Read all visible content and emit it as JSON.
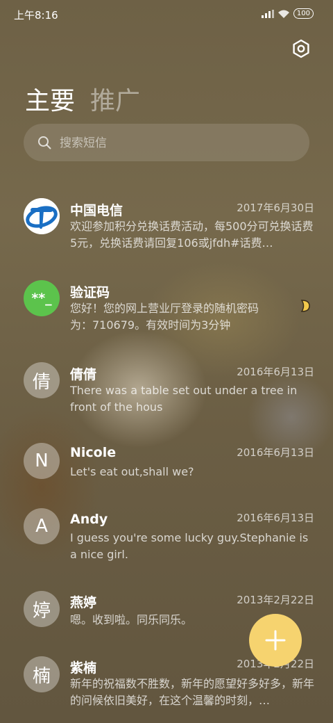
{
  "status_bar": {
    "time": "上午8:16",
    "battery": "100"
  },
  "tabs": [
    {
      "label": "主要"
    },
    {
      "label": "推广"
    }
  ],
  "search": {
    "placeholder": "搜索短信"
  },
  "conversations": [
    {
      "name": "中国电信",
      "date": "2017年6月30日",
      "preview": "欢迎参加积分兑换话费活动，每500分可兑换话费5元，兑换话费请回复106或jfdh#话费…"
    },
    {
      "name": "验证码",
      "avatar_text": "**_",
      "date": "",
      "preview": "您好！您的网上营业厅登录的随机密码为：710679。有效时间为3分钟"
    },
    {
      "name": "倩倩",
      "avatar_text": "倩",
      "date": "2016年6月13日",
      "preview": "There was a table set out under a tree in front of the hous"
    },
    {
      "name": "Nicole",
      "avatar_text": "N",
      "date": "2016年6月13日",
      "preview": "Let's eat out,shall we?"
    },
    {
      "name": "Andy",
      "avatar_text": "A",
      "date": "2016年6月13日",
      "preview": "I guess you're some lucky guy.Stephanie is a nice girl."
    },
    {
      "name": "燕婷",
      "avatar_text": "婷",
      "date": "2013年2月22日",
      "preview": "嗯。收到啦。同乐同乐。"
    },
    {
      "name": "紫楠",
      "avatar_text": "楠",
      "date": "2013年2月22日",
      "preview": "新年的祝福数不胜数，新年的愿望好多好多，新年的问候依旧美好，在这个温馨的时刻，…"
    }
  ],
  "colors": {
    "fab": "#f6d36f",
    "code_avatar": "#5cc34c",
    "telecom_blue": "#1a6fc4"
  },
  "icons": {
    "settings": "settings-icon",
    "search": "search-icon",
    "compose": "plus-icon"
  }
}
